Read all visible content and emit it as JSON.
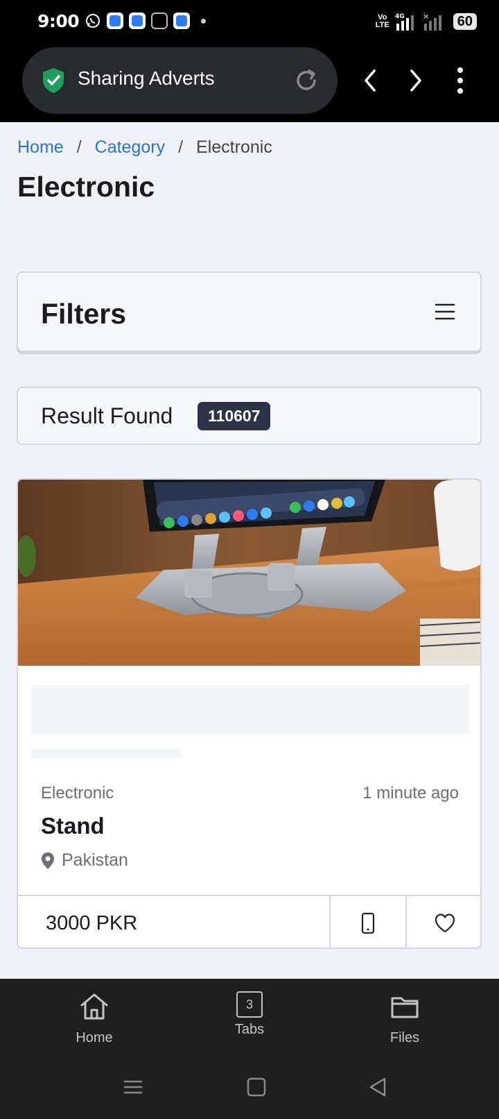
{
  "status_bar": {
    "time": "9:00",
    "volte_top": "Vo",
    "volte_bottom": "LTE",
    "network": "4G",
    "battery": "60"
  },
  "browser": {
    "site_title": "Sharing Adverts",
    "reload_icon": "reload-icon",
    "back_icon": "chevron-left-icon",
    "forward_icon": "chevron-right-icon",
    "menu_icon": "more-vert-icon"
  },
  "breadcrumb": {
    "home": "Home",
    "category": "Category",
    "current": "Electronic",
    "separator": "/"
  },
  "page_title": "Electronic",
  "filters": {
    "title": "Filters",
    "icon": "hamburger-icon"
  },
  "results": {
    "label": "Result Found",
    "count": "110607"
  },
  "listing": {
    "category": "Electronic",
    "time": "1 minute ago",
    "title": "Stand",
    "location": "Pakistan",
    "price": "3000 PKR",
    "image_alt": "tablet-stand-photo"
  },
  "bottom_nav": {
    "home": "Home",
    "tabs": "Tabs",
    "tabs_count": "3",
    "files": "Files"
  },
  "colors": {
    "accent_link": "#2b74d1",
    "badge_bg": "#2d3346",
    "shield_green": "#1e9e5a"
  }
}
